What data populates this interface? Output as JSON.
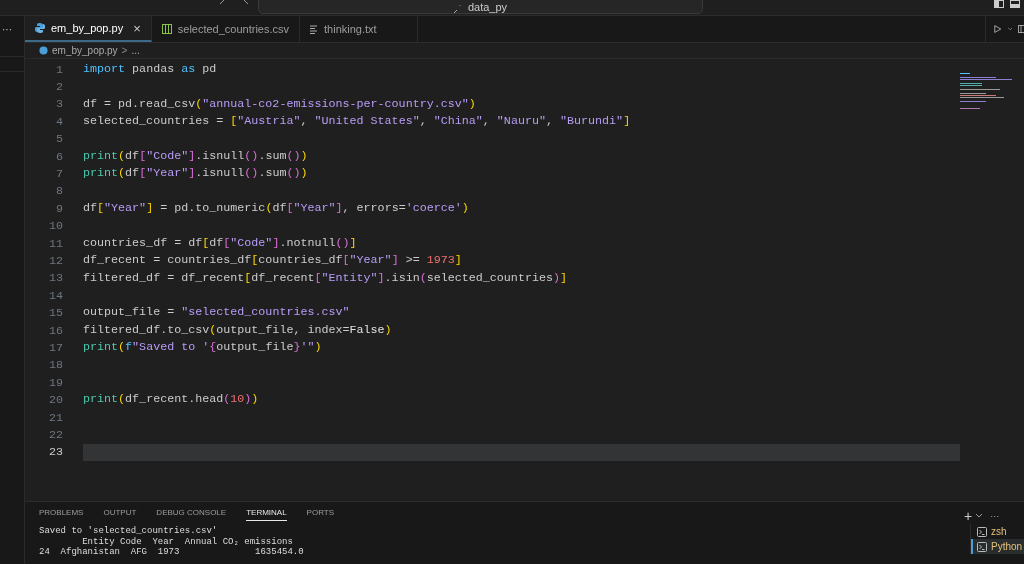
{
  "title_bar": {
    "search": "data_py"
  },
  "tabs": [
    {
      "label": "em_by_pop.py",
      "kind": "python",
      "selected": true,
      "close": "×"
    },
    {
      "label": "selected_countries.csv",
      "kind": "csv",
      "selected": false
    },
    {
      "label": "thinking.txt",
      "kind": "text",
      "selected": false
    }
  ],
  "sidebar": {
    "more": "···"
  },
  "breadcrumb": {
    "file": "em_by_pop.py",
    "separator": ">",
    "rest": "..."
  },
  "editor": {
    "lines": [
      {
        "number": "1",
        "current": false,
        "tokens": [
          {
            "t": "import",
            "kind": "kw"
          },
          {
            "t": " pandas ",
            "kind": "p"
          },
          {
            "t": "as",
            "kind": "kw"
          },
          {
            "t": " pd",
            "kind": "p"
          }
        ]
      },
      {
        "number": "2",
        "current": false
      },
      {
        "number": "3",
        "current": false,
        "tokens": [
          {
            "t": "df = pd.read_csv",
            "kind": "p"
          },
          {
            "t": "(",
            "kind": "b1"
          },
          {
            "t": "\"annual-co2-emissions-per-country.csv\"",
            "kind": "str"
          },
          {
            "t": ")",
            "kind": "b1"
          }
        ]
      },
      {
        "number": "4",
        "current": false,
        "tokens": [
          {
            "t": "selected_countries = ",
            "kind": "p"
          },
          {
            "t": "[",
            "kind": "b1"
          },
          {
            "t": "\"Austria\"",
            "kind": "str"
          },
          {
            "t": ", ",
            "kind": "p"
          },
          {
            "t": "\"United States\"",
            "kind": "str"
          },
          {
            "t": ", ",
            "kind": "p"
          },
          {
            "t": "\"China\"",
            "kind": "str"
          },
          {
            "t": ", ",
            "kind": "p"
          },
          {
            "t": "\"Nauru\"",
            "kind": "str"
          },
          {
            "t": ", ",
            "kind": "p"
          },
          {
            "t": "\"Burundi\"",
            "kind": "str"
          },
          {
            "t": "]",
            "kind": "b1"
          }
        ]
      },
      {
        "number": "5",
        "current": false
      },
      {
        "number": "6",
        "current": false,
        "tokens": [
          {
            "t": "print",
            "kind": "fn"
          },
          {
            "t": "(",
            "kind": "b1"
          },
          {
            "t": "df",
            "kind": "p"
          },
          {
            "t": "[",
            "kind": "b2"
          },
          {
            "t": "\"Code\"",
            "kind": "str"
          },
          {
            "t": "]",
            "kind": "b2"
          },
          {
            "t": ".isnull",
            "kind": "p"
          },
          {
            "t": "()",
            "kind": "b2"
          },
          {
            "t": ".sum",
            "kind": "p"
          },
          {
            "t": "()",
            "kind": "b2"
          },
          {
            "t": ")",
            "kind": "b1"
          }
        ]
      },
      {
        "number": "7",
        "current": false,
        "tokens": [
          {
            "t": "print",
            "kind": "fn"
          },
          {
            "t": "(",
            "kind": "b1"
          },
          {
            "t": "df",
            "kind": "p"
          },
          {
            "t": "[",
            "kind": "b2"
          },
          {
            "t": "\"Year\"",
            "kind": "str"
          },
          {
            "t": "]",
            "kind": "b2"
          },
          {
            "t": ".isnull",
            "kind": "p"
          },
          {
            "t": "()",
            "kind": "b2"
          },
          {
            "t": ".sum",
            "kind": "p"
          },
          {
            "t": "()",
            "kind": "b2"
          },
          {
            "t": ")",
            "kind": "b1"
          }
        ]
      },
      {
        "number": "8",
        "current": false
      },
      {
        "number": "9",
        "current": false,
        "tokens": [
          {
            "t": "df",
            "kind": "p"
          },
          {
            "t": "[",
            "kind": "b1"
          },
          {
            "t": "\"Year\"",
            "kind": "str"
          },
          {
            "t": "]",
            "kind": "b1"
          },
          {
            "t": " = pd.to_numeric",
            "kind": "p"
          },
          {
            "t": "(",
            "kind": "b1"
          },
          {
            "t": "df",
            "kind": "p"
          },
          {
            "t": "[",
            "kind": "b2"
          },
          {
            "t": "\"Year\"",
            "kind": "str"
          },
          {
            "t": "]",
            "kind": "b2"
          },
          {
            "t": ", errors=",
            "kind": "p"
          },
          {
            "t": "'coerce'",
            "kind": "str"
          },
          {
            "t": ")",
            "kind": "b1"
          }
        ]
      },
      {
        "number": "10",
        "current": false
      },
      {
        "number": "11",
        "current": false,
        "tokens": [
          {
            "t": "countries_df = df",
            "kind": "p"
          },
          {
            "t": "[",
            "kind": "b1"
          },
          {
            "t": "df",
            "kind": "p"
          },
          {
            "t": "[",
            "kind": "b2"
          },
          {
            "t": "\"Code\"",
            "kind": "str"
          },
          {
            "t": "]",
            "kind": "b2"
          },
          {
            "t": ".notnull",
            "kind": "p"
          },
          {
            "t": "()",
            "kind": "b2"
          },
          {
            "t": "]",
            "kind": "b1"
          }
        ]
      },
      {
        "number": "12",
        "current": false,
        "tokens": [
          {
            "t": "df_recent = countries_df",
            "kind": "p"
          },
          {
            "t": "[",
            "kind": "b1"
          },
          {
            "t": "countries_df",
            "kind": "p"
          },
          {
            "t": "[",
            "kind": "b2"
          },
          {
            "t": "\"Year\"",
            "kind": "str"
          },
          {
            "t": "]",
            "kind": "b2"
          },
          {
            "t": " >= ",
            "kind": "p"
          },
          {
            "t": "1973",
            "kind": "num"
          },
          {
            "t": "]",
            "kind": "b1"
          }
        ]
      },
      {
        "number": "13",
        "current": false,
        "tokens": [
          {
            "t": "filtered_df = df_recent",
            "kind": "p"
          },
          {
            "t": "[",
            "kind": "b1"
          },
          {
            "t": "df_recent",
            "kind": "p"
          },
          {
            "t": "[",
            "kind": "b2"
          },
          {
            "t": "\"Entity\"",
            "kind": "str"
          },
          {
            "t": "]",
            "kind": "b2"
          },
          {
            "t": ".isin",
            "kind": "p"
          },
          {
            "t": "(",
            "kind": "b2"
          },
          {
            "t": "selected_countries",
            "kind": "p"
          },
          {
            "t": ")",
            "kind": "b2"
          },
          {
            "t": "]",
            "kind": "b1"
          }
        ]
      },
      {
        "number": "14",
        "current": false
      },
      {
        "number": "15",
        "current": false,
        "tokens": [
          {
            "t": "output_file = ",
            "kind": "p"
          },
          {
            "t": "\"selected_countries.csv\"",
            "kind": "str"
          }
        ]
      },
      {
        "number": "16",
        "current": false,
        "tokens": [
          {
            "t": "filtered_df.to_csv",
            "kind": "p"
          },
          {
            "t": "(",
            "kind": "b1"
          },
          {
            "t": "output_file, index=",
            "kind": "p"
          },
          {
            "t": "False",
            "kind": "const"
          },
          {
            "t": ")",
            "kind": "b1"
          }
        ]
      },
      {
        "number": "17",
        "current": false,
        "tokens": [
          {
            "t": "print",
            "kind": "fn"
          },
          {
            "t": "(",
            "kind": "b1"
          },
          {
            "t": "f",
            "kind": "kw"
          },
          {
            "t": "\"Saved to '",
            "kind": "str"
          },
          {
            "t": "{",
            "kind": "b2"
          },
          {
            "t": "output_file",
            "kind": "p"
          },
          {
            "t": "}",
            "kind": "b2"
          },
          {
            "t": "'\"",
            "kind": "str"
          },
          {
            "t": ")",
            "kind": "b1"
          }
        ]
      },
      {
        "number": "18",
        "current": false
      },
      {
        "number": "19",
        "current": false
      },
      {
        "number": "20",
        "current": false,
        "tokens": [
          {
            "t": "print",
            "kind": "fn"
          },
          {
            "t": "(",
            "kind": "b1"
          },
          {
            "t": "df_recent.head",
            "kind": "p"
          },
          {
            "t": "(",
            "kind": "b2"
          },
          {
            "t": "10",
            "kind": "num"
          },
          {
            "t": ")",
            "kind": "b2"
          },
          {
            "t": ")",
            "kind": "b1"
          }
        ]
      },
      {
        "number": "21",
        "current": false
      },
      {
        "number": "22",
        "current": false
      },
      {
        "number": "23",
        "current": true
      }
    ]
  },
  "panel": {
    "tabs": [
      {
        "label": "PROBLEMS",
        "selected": false
      },
      {
        "label": "OUTPUT",
        "selected": false
      },
      {
        "label": "DEBUG CONSOLE",
        "selected": false
      },
      {
        "label": "TERMINAL",
        "selected": true
      },
      {
        "label": "PORTS",
        "selected": false
      }
    ],
    "add": "+",
    "more": "···",
    "terminal_lines": [
      "Saved to 'selected_countries.csv'",
      "        Entity Code  Year  Annual CO₂ emissions",
      "24  Afghanistan  AFG  1973              1635454.0"
    ],
    "terminals": [
      {
        "label": "zsh",
        "selected": false
      },
      {
        "label": "Python",
        "selected": true
      }
    ]
  }
}
